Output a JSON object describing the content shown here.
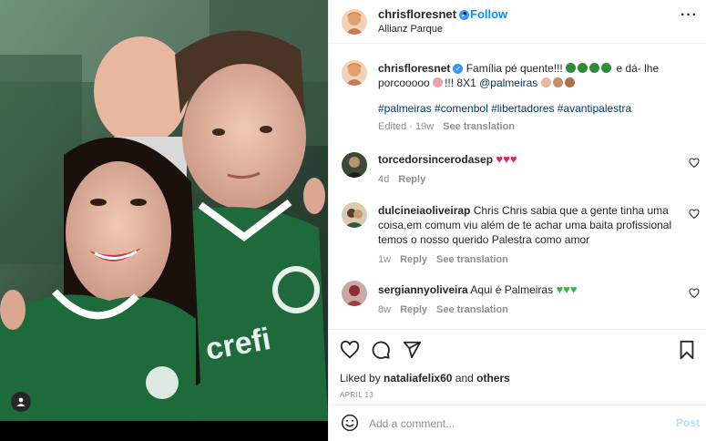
{
  "header": {
    "username": "chrisfloresnet",
    "separator": "•",
    "follow_label": "Follow",
    "location": "Allianz Parque",
    "more_label": "···"
  },
  "caption": {
    "username": "chrisfloresnet",
    "text_part1": "Família pé quente!!!",
    "text_part2": "e dá- lhe",
    "text_line2_a": "porcooooo",
    "text_line2_b": "!!! 8X1",
    "mention": "@palmeiras",
    "hashtags": "#palmeiras #comenbol #libertadores #avantipalestra",
    "edited": "Edited",
    "age": "19w",
    "translation": "See translation"
  },
  "comments": [
    {
      "username": "torcedorsincerodasep",
      "text": "",
      "age": "4d",
      "reply": "Reply",
      "translation": ""
    },
    {
      "username": "dulcineiaoliveirap",
      "text_line1": "Chris Chris sabia que a gente tinha uma",
      "text_line2": "coisa,em comum viu além de te achar uma baita profissional",
      "text_line3": "temos o nosso querido Palestra como amor",
      "age": "1w",
      "reply": "Reply",
      "translation": "See translation"
    },
    {
      "username": "sergiannyoliveira",
      "text": "Aqui é Palmeiras",
      "age": "8w",
      "reply": "Reply",
      "translation": "See translation"
    }
  ],
  "likes": {
    "prefix": "Liked by",
    "user": "nataliafelix60",
    "and": "and",
    "others": "others"
  },
  "date": "APRIL 13",
  "add_comment": {
    "placeholder": "Add a comment...",
    "post_label": "Post"
  },
  "colors": {
    "accent": "#0095f6",
    "verified": "#3897f0",
    "hashtag": "#00376b",
    "secondary_text": "#8e8e8e",
    "heart_red": "#e0245e",
    "clover_green": "#2e8b3a"
  },
  "icons": {
    "like": "heart-icon",
    "comment": "comment-icon",
    "share": "share-icon",
    "save": "bookmark-icon",
    "emoji": "emoji-icon",
    "user_tag": "user-tag-icon"
  }
}
